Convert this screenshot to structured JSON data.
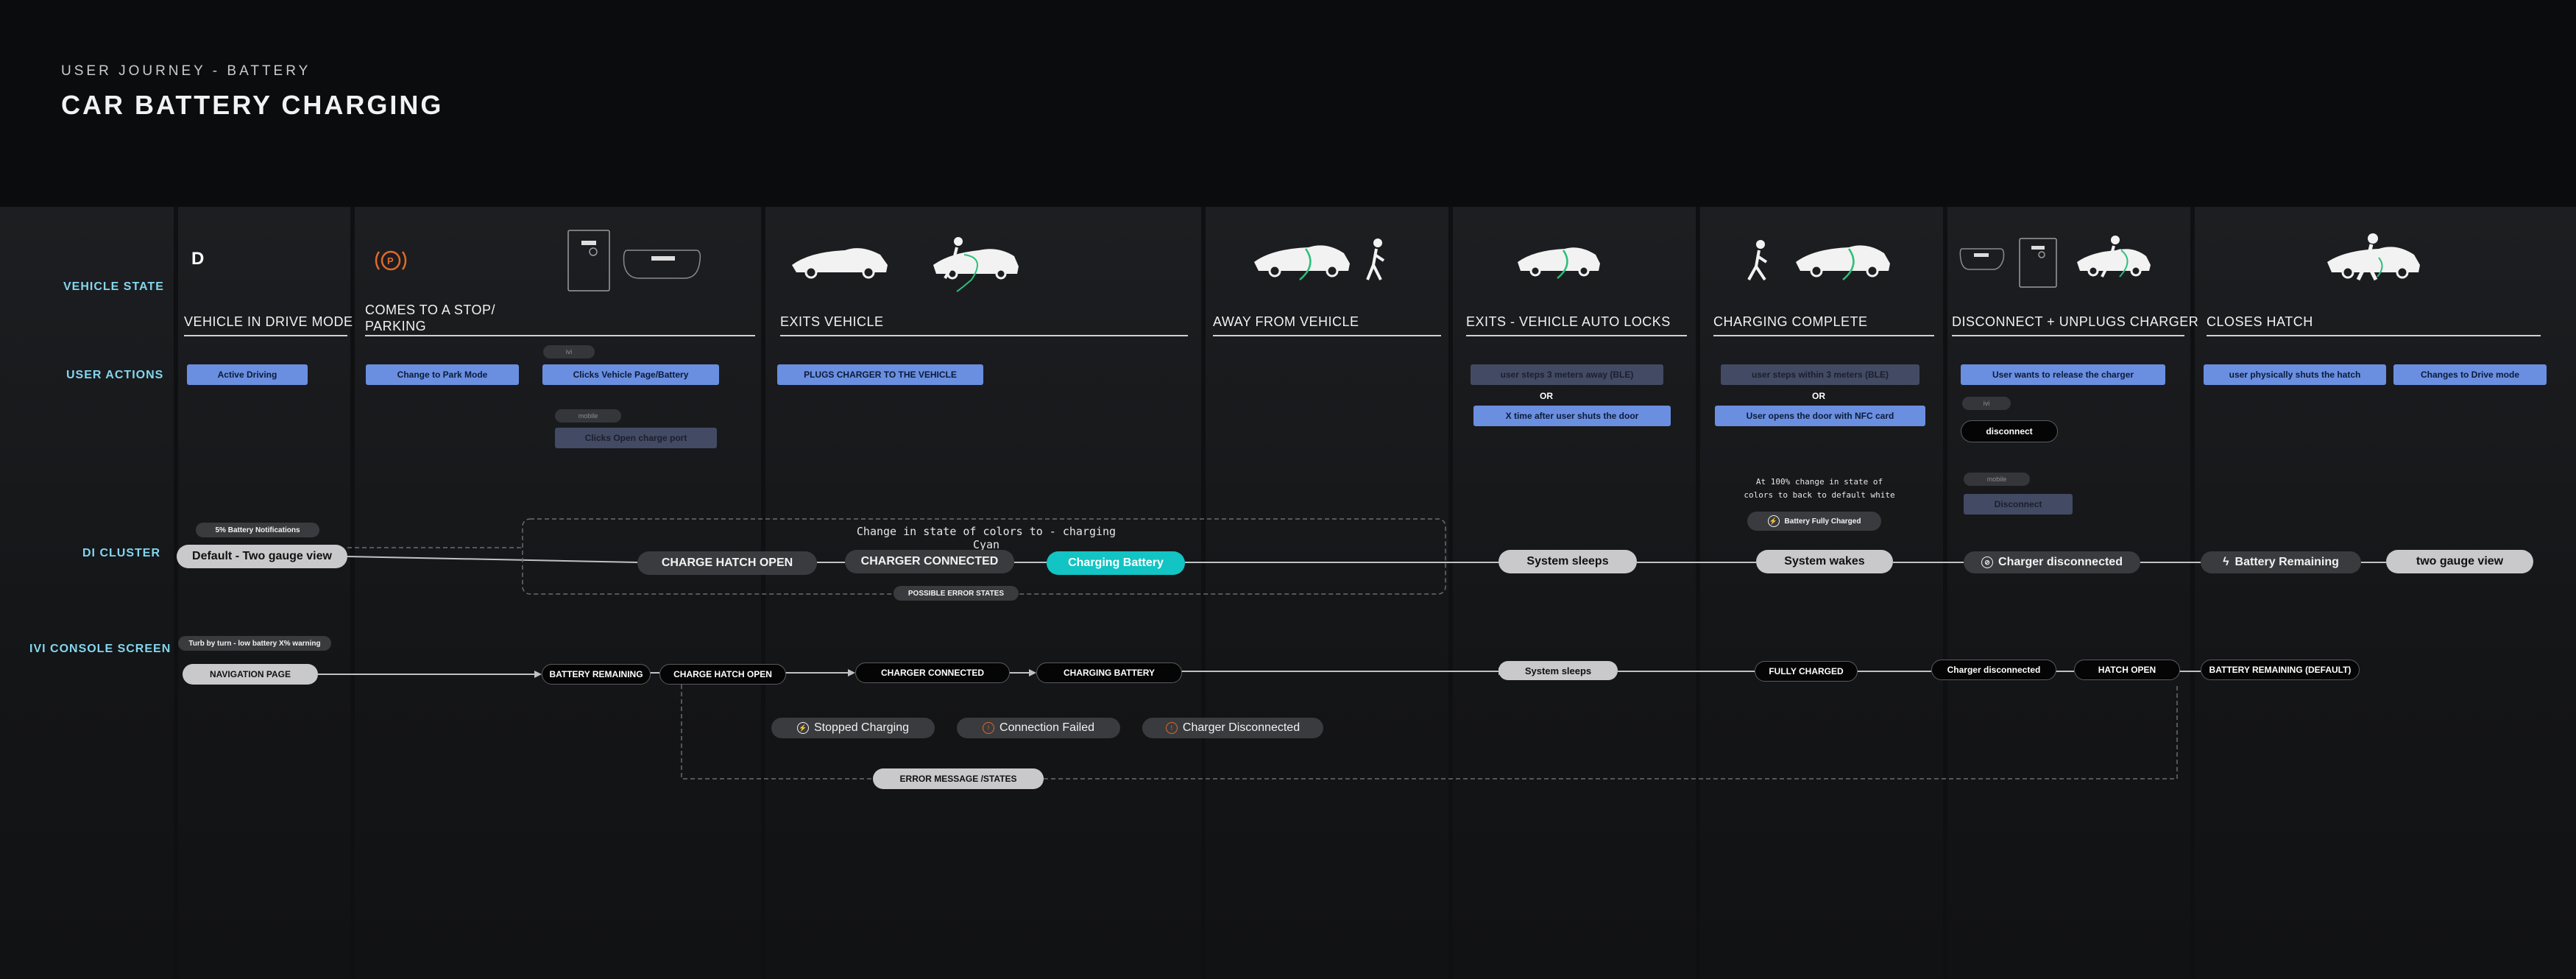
{
  "header": {
    "subtitle": "USER JOURNEY - BATTERY",
    "title": "CAR BATTERY CHARGING"
  },
  "lanes": {
    "vehicle_state": "VEHICLE STATE",
    "user_actions": "USER ACTIONS",
    "di_cluster": "DI CLUSTER",
    "ivi": "IVI CONSOLE SCREEN"
  },
  "phases": {
    "drive": "VEHICLE IN DRIVE MODE",
    "stop": "COMES TO A STOP/ PARKING",
    "exits": "EXITS VEHICLE",
    "away": "AWAY FROM VEHICLE",
    "autolock": "EXITS - VEHICLE AUTO LOCKS",
    "complete": "CHARGING COMPLETE",
    "disconnect": "DISCONNECT + UNPLUGS CHARGER",
    "closes": "CLOSES HATCH"
  },
  "vehicle_state": {
    "gear_letter": "D"
  },
  "actions": {
    "active_driving": "Active Driving",
    "park_mode": "Change to Park Mode",
    "clicks_vehicle": "Clicks Vehicle Page/Battery",
    "clicks_open_port": "Clicks Open charge port",
    "plugs_charger": "PLUGS CHARGER TO THE VEHICLE",
    "steps_away": "user steps 3 meters away (BLE)",
    "or1": "OR",
    "x_time": "X time after user shuts the door",
    "steps_within": "user steps within 3 meters (BLE)",
    "or2": "OR",
    "opens_nfc": "User opens the door with NFC card",
    "release_charger": "User wants to release the charger",
    "disconnect": "disconnect",
    "disconnect_btn": "Disconnect",
    "shuts_hatch": "user physically shuts the hatch",
    "drive_mode": "Changes to Drive mode"
  },
  "tags": {
    "ivi_tag": "ivi",
    "mobile_tag": "mobile",
    "ivi_tag2": "ivi",
    "mobile_tag2": "mobile"
  },
  "cluster": {
    "notif": "5% Battery Notifications",
    "default": "Default - Two gauge view",
    "change_note": "Change in state of colors to - charging Cyan",
    "hatch_open": "CHARGE HATCH OPEN",
    "charger_connected": "CHARGER CONNECTED",
    "charging_battery": "Charging Battery",
    "possible_errors": "POSSIBLE ERROR STATES",
    "system_sleeps": "System sleeps",
    "full_note_1": "At 100% change in state of",
    "full_note_2": "colors to back to default white",
    "fully_charged": "Battery Fully Charged",
    "system_wakes": "System wakes",
    "charger_disconnected": "Charger disconnected",
    "battery_remaining": "Battery Remaining",
    "two_gauge": "two gauge view"
  },
  "ivi": {
    "turn_warning": "Turb by turn - low battery X% warning",
    "nav_page": "NAVIGATION PAGE",
    "battery_remaining": "BATTERY REMAINING",
    "hatch_open": "CHARGE HATCH OPEN",
    "charger_connected": "CHARGER CONNECTED",
    "charging_battery": "CHARGING BATTERY",
    "system_sleeps": "System sleeps",
    "fully_charged": "FULLY CHARGED",
    "charger_disconnected": "Charger disconnected",
    "hatch_open2": "HATCH OPEN",
    "battery_default": "BATTERY REMAINING (DEFAULT)",
    "stopped_charging": "Stopped Charging",
    "connection_failed": "Connection Failed",
    "charger_disconnected_err": "Charger Disconnected",
    "error_states": "ERROR MESSAGE /STATES"
  },
  "colors": {
    "accent_cyan": "#12c4c4",
    "action_blue": "#6a8fe0",
    "lane_label": "#83d6ee",
    "error_orange": "#e06a2a"
  }
}
